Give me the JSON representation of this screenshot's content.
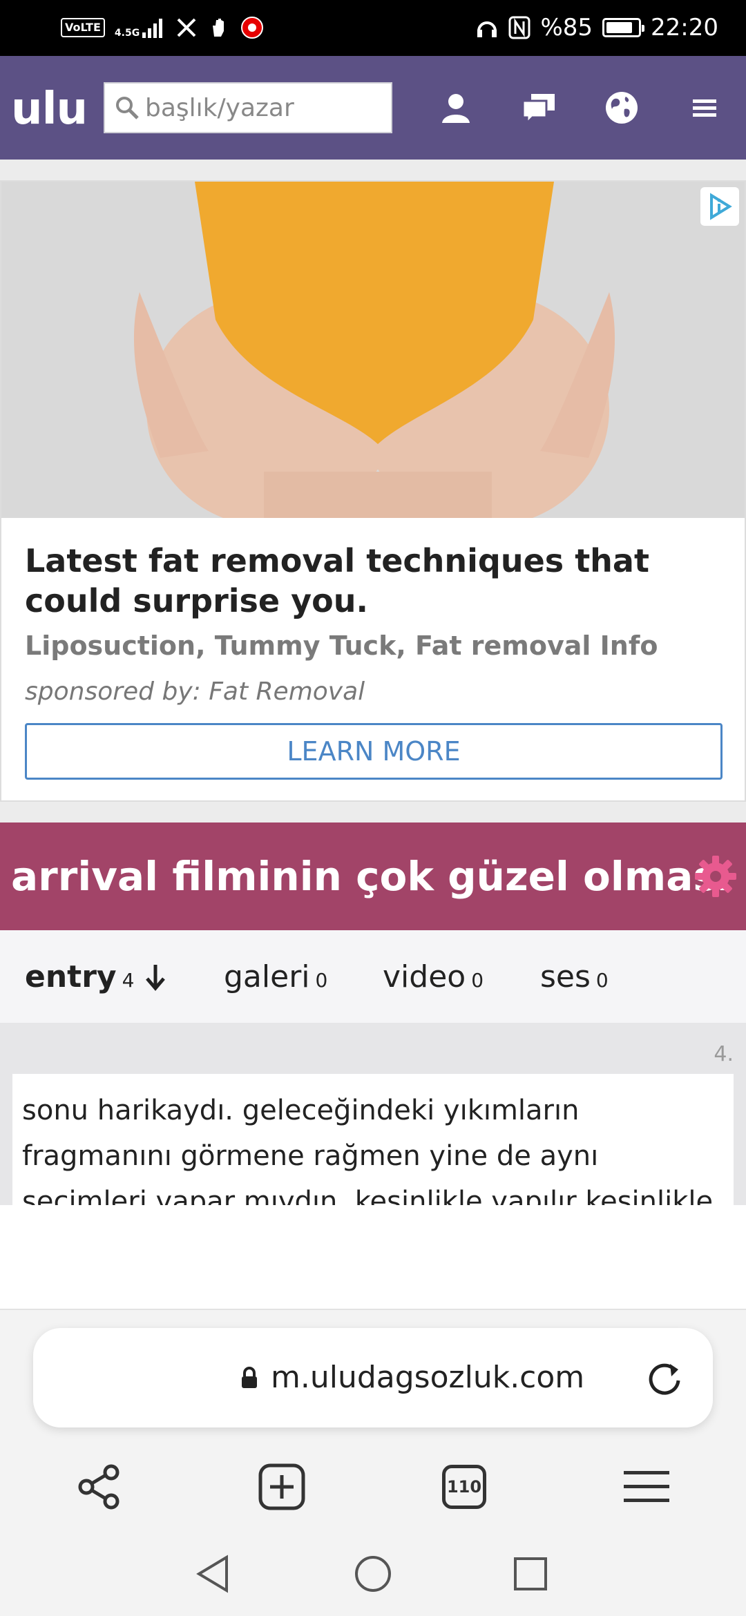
{
  "status_bar": {
    "volte": "VoLTE",
    "network": "4.5G",
    "battery": "%85",
    "battery_level": 0.85,
    "time": "22:20",
    "icons": [
      "signal-icon",
      "x-icon",
      "hand-icon",
      "vodafone-icon",
      "headphones-icon",
      "nfc-icon",
      "battery-icon"
    ]
  },
  "header": {
    "logo": "ulu",
    "search_placeholder": "başlık/yazar",
    "icons": [
      "user-icon",
      "messages-icon",
      "globe-icon",
      "menu-icon"
    ],
    "bg_color": "#5c5185"
  },
  "ad": {
    "title": "Latest fat removal techniques that could surprise you.",
    "subtitle": "Liposuction, Tummy Tuck, Fat removal Info",
    "sponsor": "sponsored by: Fat Removal",
    "cta": "LEARN MORE"
  },
  "topic": {
    "title": "arrival filminin çok güzel olması",
    "bg_color": "#a24468"
  },
  "tabs": [
    {
      "label": "entry",
      "count": "4"
    },
    {
      "label": "galeri",
      "count": "0"
    },
    {
      "label": "video",
      "count": "0"
    },
    {
      "label": "ses",
      "count": "0"
    }
  ],
  "entry": {
    "number": "4.",
    "text": "sonu harikaydı. geleceğindeki yıkımların fragmanını görmene rağmen yine de aynı seçimleri yapar mıydın. kesinlikle yapılır kesinlikle."
  },
  "browser": {
    "url": "m.uludagsozluk.com",
    "tab_count": "110"
  }
}
